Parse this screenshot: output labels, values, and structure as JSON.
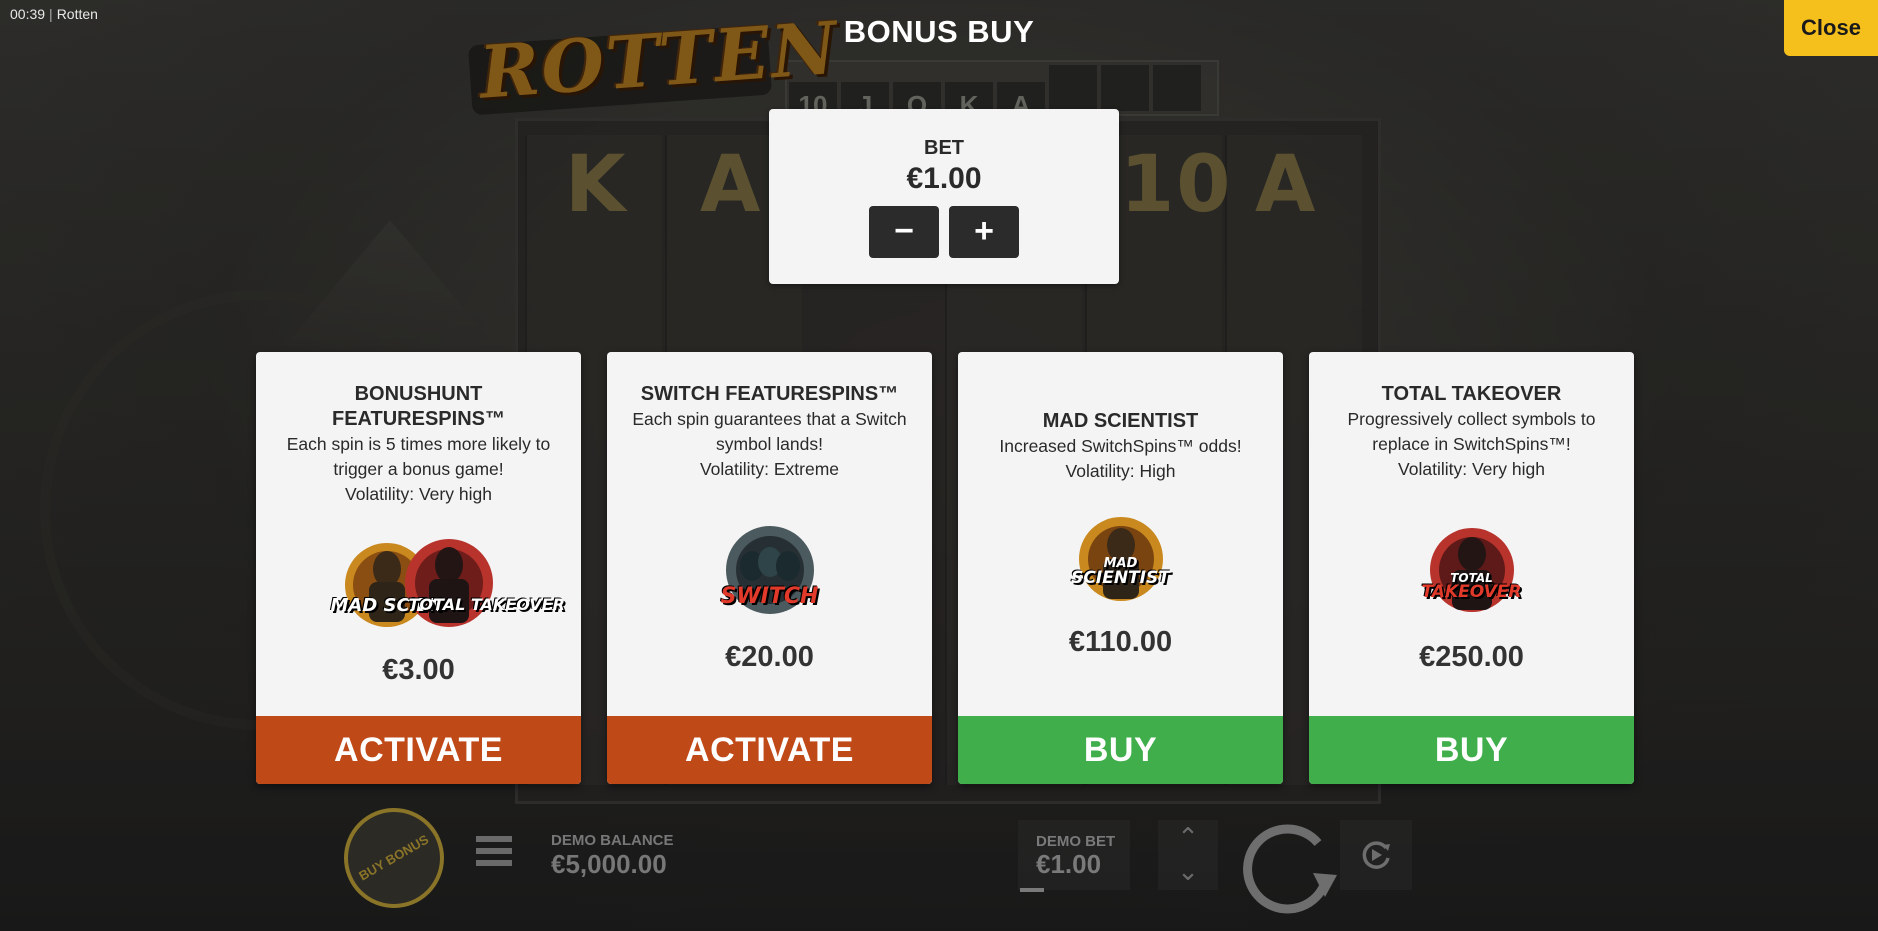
{
  "topbar": {
    "time": "00:39",
    "separator": "|",
    "game_name": "Rotten",
    "title": "BONUS BUY",
    "close_label": "Close"
  },
  "background": {
    "logo_text": "ROTTEN",
    "top_strip": [
      "10",
      "J",
      "Q",
      "K",
      "A",
      "",
      "",
      ""
    ],
    "reel_letters": [
      "K",
      "A",
      "",
      "10",
      "A"
    ]
  },
  "bet": {
    "label": "BET",
    "value": "€1.00",
    "minus_label": "−",
    "plus_label": "+"
  },
  "cards": [
    {
      "title": "BONUSHUNT FEATURESPINS™",
      "description": "Each spin is 5 times more likely to trigger a bonus game!",
      "volatility": "Volatility: Very high",
      "icon": "mad-scientist-total-takeover-badge",
      "badge_texts": [
        "MAD SCIEN",
        "TOTAL TAKEOVER"
      ],
      "price": "€3.00",
      "action": "ACTIVATE",
      "action_color": "#c04918"
    },
    {
      "title": "SWITCH FEATURESPINS™",
      "description": "Each spin guarantees that a Switch symbol lands!",
      "volatility": "Volatility: Extreme",
      "icon": "switch-badge",
      "badge_texts": [
        "SWITCH"
      ],
      "price": "€20.00",
      "action": "ACTIVATE",
      "action_color": "#c04918"
    },
    {
      "title": "MAD SCIENTIST",
      "description": "Increased SwitchSpins™ odds!",
      "volatility": "Volatility: High",
      "icon": "mad-scientist-badge",
      "badge_texts": [
        "MAD",
        "SCIENTIST"
      ],
      "price": "€110.00",
      "action": "BUY",
      "action_color": "#3fae4b"
    },
    {
      "title": "TOTAL TAKEOVER",
      "description": "Progressively collect symbols to replace in SwitchSpins™!",
      "volatility": "Volatility: Very high",
      "icon": "total-takeover-badge",
      "badge_texts": [
        "TOTAL",
        "TAKEOVER"
      ],
      "price": "€250.00",
      "action": "BUY",
      "action_color": "#3fae4b"
    }
  ],
  "bottombar": {
    "buy_bonus_label": "BUY BONUS",
    "balance_label": "DEMO BALANCE",
    "balance_value": "€5,000.00",
    "demo_bet_label": "DEMO BET",
    "demo_bet_value": "€1.00",
    "up_arrow": "⌃",
    "down_arrow": "⌄"
  },
  "colors": {
    "close": "#f6c01c",
    "activate": "#c04918",
    "buy": "#3fae4b",
    "panel": "#f4f4f4"
  }
}
